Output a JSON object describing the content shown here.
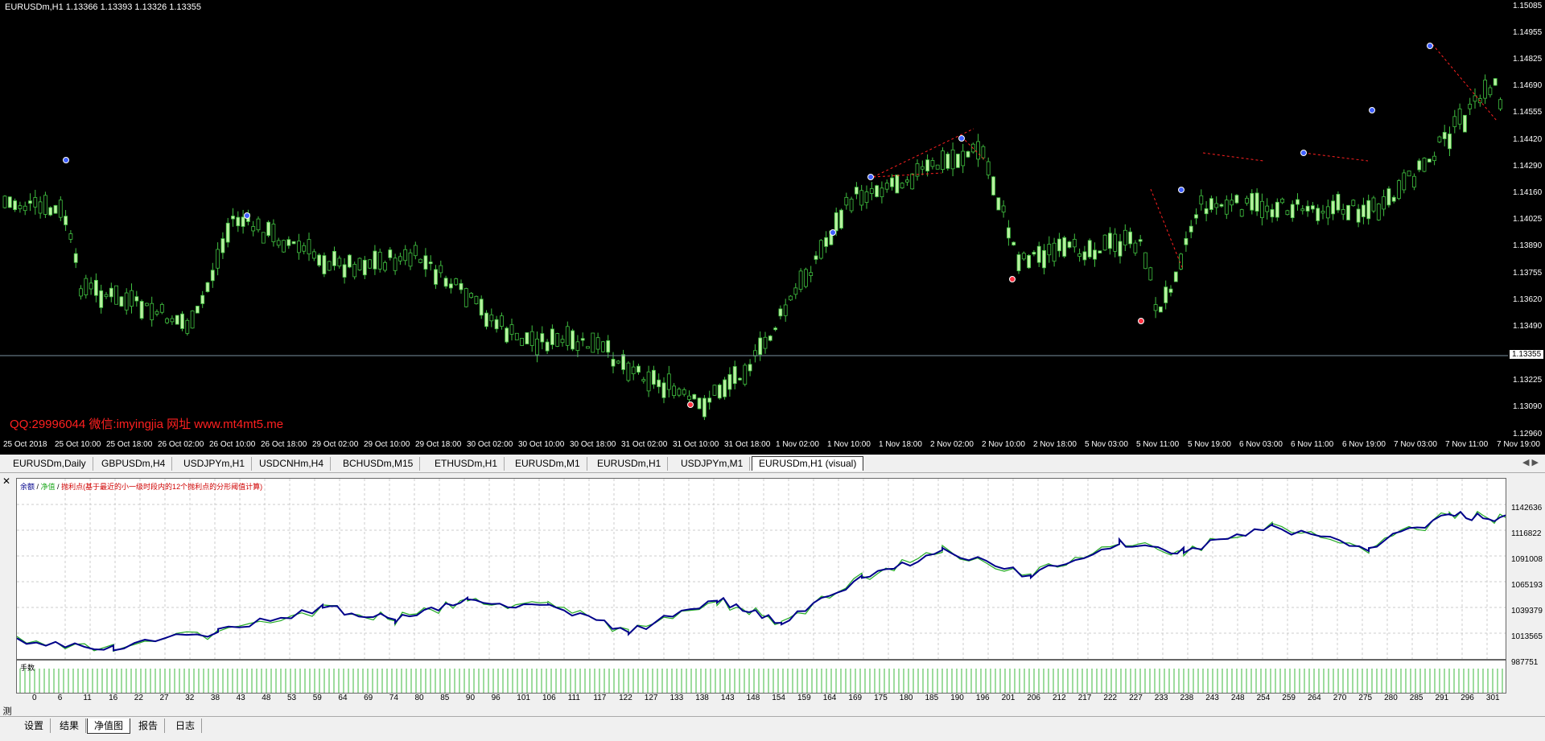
{
  "chart": {
    "symbol_info": "EURUSDm,H1  1.13366 1.13393 1.13326 1.13355",
    "watermark": "QQ:29996044 微信:imyingjia 网址 www.mt4mt5.me",
    "current_price": "1.13355",
    "price_ticks": [
      "1.15085",
      "1.14955",
      "1.14825",
      "1.14690",
      "1.14555",
      "1.14420",
      "1.14290",
      "1.14160",
      "1.14025",
      "1.13890",
      "1.13755",
      "1.13620",
      "1.13490",
      "1.13225",
      "1.13090",
      "1.12960"
    ],
    "time_ticks": [
      "25 Oct 2018",
      "25 Oct 10:00",
      "25 Oct 18:00",
      "26 Oct 02:00",
      "26 Oct 10:00",
      "26 Oct 18:00",
      "29 Oct 02:00",
      "29 Oct 10:00",
      "29 Oct 18:00",
      "30 Oct 02:00",
      "30 Oct 10:00",
      "30 Oct 18:00",
      "31 Oct 02:00",
      "31 Oct 10:00",
      "31 Oct 18:00",
      "1 Nov 02:00",
      "1 Nov 10:00",
      "1 Nov 18:00",
      "2 Nov 02:00",
      "2 Nov 10:00",
      "2 Nov 18:00",
      "5 Nov 03:00",
      "5 Nov 11:00",
      "5 Nov 19:00",
      "6 Nov 03:00",
      "6 Nov 11:00",
      "6 Nov 19:00",
      "7 Nov 03:00",
      "7 Nov 11:00",
      "7 Nov 19:00"
    ],
    "colors": {
      "bull": "#b8f0a0",
      "bear": "#000000",
      "wick": "#40c040",
      "bg": "#000000"
    }
  },
  "symbol_tabs": [
    "EURUSDm,Daily",
    "GBPUSDm,H4",
    "USDJPYm,H1",
    "USDCNHm,H4",
    "BCHUSDm,M15",
    "ETHUSDm,H1",
    "EURUSDm,M1",
    "EURUSDm,H1",
    "USDJPYm,M1",
    "EURUSDm,H1 (visual)"
  ],
  "tester": {
    "vertical_title": "测试",
    "close": "✕",
    "legend": {
      "balance": "余额",
      "sep1": " / ",
      "equity": "净值",
      "sep2": " / ",
      "desc": "抛利点(基于最近的小一级时段内的12个抛利点的分形阈值计算)"
    },
    "equity_ticks": [
      "1142636",
      "1116822",
      "1091008",
      "1065193",
      "1039379",
      "1013565",
      "987751"
    ],
    "lots_label": "手数",
    "x_ticks": [
      "0",
      "6",
      "11",
      "16",
      "22",
      "27",
      "32",
      "38",
      "43",
      "48",
      "53",
      "59",
      "64",
      "69",
      "74",
      "80",
      "85",
      "90",
      "96",
      "101",
      "106",
      "111",
      "117",
      "122",
      "127",
      "133",
      "138",
      "143",
      "148",
      "154",
      "159",
      "164",
      "169",
      "175",
      "180",
      "185",
      "190",
      "196",
      "201",
      "206",
      "212",
      "217",
      "222",
      "227",
      "233",
      "238",
      "243",
      "248",
      "254",
      "259",
      "264",
      "270",
      "275",
      "280",
      "285",
      "291",
      "296",
      "301"
    ],
    "colors": {
      "balance": "#00008b",
      "equity": "#22aa22",
      "lots": "#3cb83c"
    }
  },
  "bottom_tabs": [
    "设置",
    "结果",
    "净值图",
    "报告",
    "日志"
  ],
  "active_bottom_tab": 2
}
